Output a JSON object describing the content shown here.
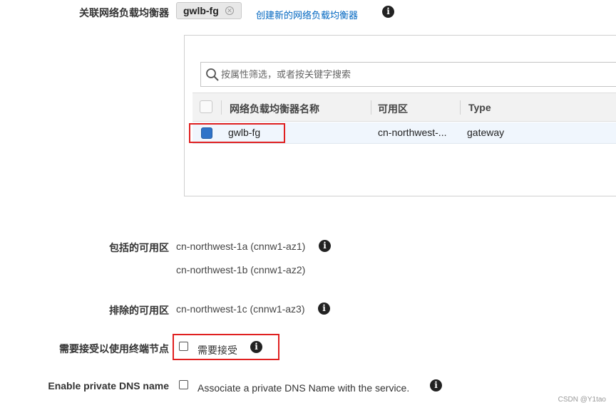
{
  "gwlb": {
    "label": "关联网络负载均衡器",
    "chip_text": "gwlb-fg",
    "create_link": "创建新的网络负载均衡器"
  },
  "search": {
    "placeholder": "按属性筛选，或者按关键字搜索"
  },
  "table": {
    "columns": [
      "网络负载均衡器名称",
      "可用区",
      "Type"
    ],
    "rows": [
      {
        "name": "gwlb-fg",
        "az": "cn-northwest-...",
        "type": "gateway",
        "selected": true
      }
    ]
  },
  "included": {
    "label": "包括的可用区",
    "values": [
      "cn-northwest-1a (cnnw1-az1)",
      "cn-northwest-1b (cnnw1-az2)"
    ]
  },
  "excluded": {
    "label": "排除的可用区",
    "value": "cn-northwest-1c (cnnw1-az3)"
  },
  "acceptance": {
    "label": "需要接受以使用终端节点",
    "checkbox_label": "需要接受",
    "checked": false
  },
  "dns": {
    "label": "Enable private DNS name",
    "checkbox_label": "Associate a private DNS Name with the service.",
    "checked": false
  },
  "watermark": "CSDN @Y1tao",
  "colors": {
    "link": "#0066c0",
    "highlight": "#e02020",
    "selected": "#2f73c8"
  }
}
